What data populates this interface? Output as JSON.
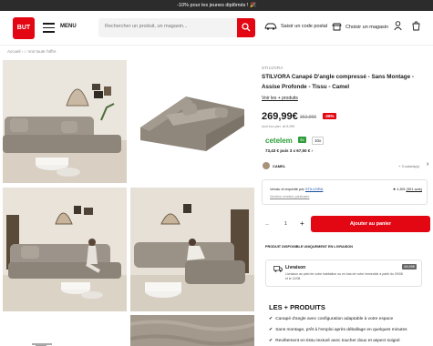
{
  "promo": {
    "text": "-10% pour les jeunes diplômés ! 🎉"
  },
  "header": {
    "logo": "BUT",
    "menu_label": "MENU",
    "search_placeholder": "Rechercher un produit, un magasin...",
    "postal_label": "Saisir un code postal",
    "store_label": "Choisir un magasin"
  },
  "breadcrumb": "Accueil  ›  ⌂  Voir toute l'offre",
  "product": {
    "brand": "STILVORA",
    "title": "STILVORA Canapé D'angle compressé - Sans Montage - Assise Profonde - Tissu - Camel",
    "variants_link": "Voir les + produits",
    "price": "269,99€",
    "old_price": "362,99€",
    "discount": "-26%",
    "ecotax": "dont éco-part. de 8,99€",
    "cetelem": "cetelem",
    "tag_4x": "4x",
    "tag_10x": "10x",
    "credit": "73,43 € puis 3 x 67,50 €  ›",
    "color_name": "CAMEL",
    "colors_more": "+ 3 coloris(s)"
  },
  "seller": {
    "sold_by_prefix": "Vendu et expédié par ",
    "seller_name": "STILVORA",
    "partner_link": "Vendeur vendeur partenaire",
    "rating": "★ 4,5/5",
    "reviews": "(301 avis)"
  },
  "cart": {
    "minus": "–",
    "qty": "1",
    "plus": "+",
    "add_label": "Ajouter au panier"
  },
  "delivery": {
    "only_label": "PRODUIT DISPONIBLE UNIQUEMENT EN LIVRAISON",
    "title": "Livraison",
    "price": "69,99€",
    "desc": "Livraison au pied de votre habitation ou en bas de votre immeuble à partir du 09/08 et le 12/08"
  },
  "features": {
    "title": "LES + PRODUITS",
    "items": [
      "Canapé d'angle avec configuration adaptable à votre espace",
      "Sans montage, prêt à l'emploi après déballage en quelques minutes",
      "Revêtement en tissu texturé avec toucher doux et aspect soigné"
    ]
  },
  "colors": {
    "brand_red": "#e30613",
    "cetelem_green": "#2e9d3a",
    "sofa": "#9c9488"
  }
}
